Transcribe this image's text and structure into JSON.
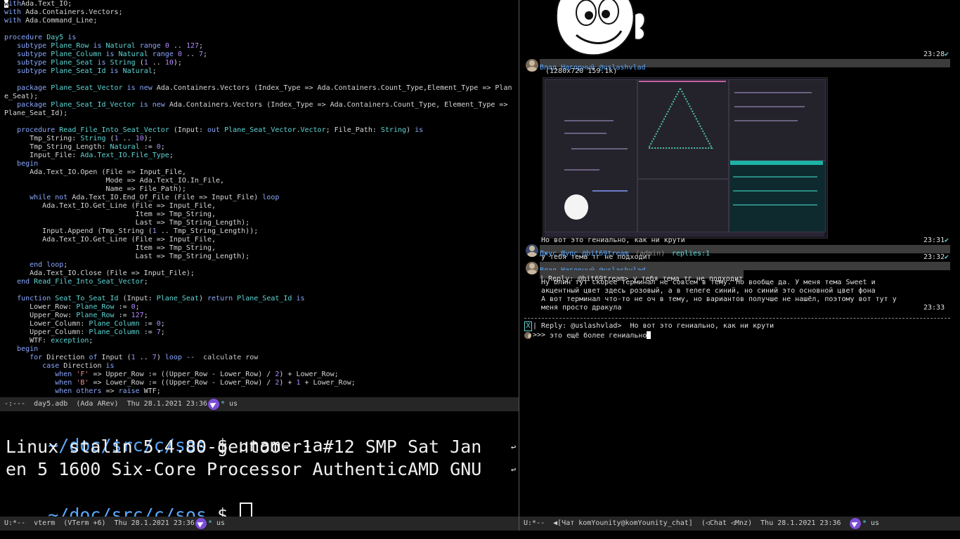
{
  "editor": {
    "lines": [
      [
        [
          "cur",
          "w"
        ],
        [
          "kw",
          "ith"
        ],
        [
          "",
          "Ada.Text_IO;"
        ]
      ],
      [
        [
          "kw",
          "with "
        ],
        [
          "",
          "Ada.Containers.Vectors;"
        ]
      ],
      [
        [
          "kw",
          "with "
        ],
        [
          "",
          "Ada.Command_Line;"
        ]
      ],
      [],
      [
        [
          "kw",
          "procedure "
        ],
        [
          "ty",
          "Day5 "
        ],
        [
          "kw",
          "is"
        ]
      ],
      [
        [
          "",
          "   "
        ],
        [
          "kw",
          "subtype "
        ],
        [
          "ty",
          "Plane_Row "
        ],
        [
          "kw",
          "is "
        ],
        [
          "ty",
          "Natural "
        ],
        [
          "kw",
          "range "
        ],
        [
          "nm",
          "0"
        ],
        [
          "",
          " .. "
        ],
        [
          "nm",
          "127"
        ],
        [
          "",
          ";"
        ]
      ],
      [
        [
          "",
          "   "
        ],
        [
          "kw",
          "subtype "
        ],
        [
          "ty",
          "Plane_Column "
        ],
        [
          "kw",
          "is "
        ],
        [
          "ty",
          "Natural "
        ],
        [
          "kw",
          "range "
        ],
        [
          "nm",
          "0"
        ],
        [
          "",
          " .. "
        ],
        [
          "nm",
          "7"
        ],
        [
          "",
          ";"
        ]
      ],
      [
        [
          "",
          "   "
        ],
        [
          "kw",
          "subtype "
        ],
        [
          "ty",
          "Plane_Seat "
        ],
        [
          "kw",
          "is "
        ],
        [
          "ty",
          "String "
        ],
        [
          "",
          "("
        ],
        [
          "nm",
          "1"
        ],
        [
          "",
          " .. "
        ],
        [
          "nm",
          "10"
        ],
        [
          "",
          "); "
        ]
      ],
      [
        [
          "",
          "   "
        ],
        [
          "kw",
          "subtype "
        ],
        [
          "ty",
          "Plane_Seat_Id "
        ],
        [
          "kw",
          "is "
        ],
        [
          "ty",
          "Natural"
        ],
        [
          "",
          ";"
        ]
      ],
      [],
      [
        [
          "",
          "   "
        ],
        [
          "kw",
          "package "
        ],
        [
          "ty",
          "Plane_Seat_Vector "
        ],
        [
          "kw",
          "is new "
        ],
        [
          "",
          "Ada.Containers.Vectors (Index_Type => Ada.Containers.Count_Type,Element_Type => Plan "
        ]
      ],
      [
        [
          "",
          "e_Seat);"
        ]
      ],
      [
        [
          "",
          "   "
        ],
        [
          "kw",
          "package "
        ],
        [
          "ty",
          "Plane_Seat_Id_Vector "
        ],
        [
          "kw",
          "is new "
        ],
        [
          "",
          "Ada.Containers.Vectors (Index_Type => Ada.Containers.Count_Type, Element_Type => "
        ]
      ],
      [
        [
          "",
          "Plane_Seat_Id);"
        ]
      ],
      [],
      [
        [
          "",
          "   "
        ],
        [
          "kw",
          "procedure "
        ],
        [
          "ty",
          "Read_File_Into_Seat_Vector "
        ],
        [
          "",
          "(Input: "
        ],
        [
          "kw",
          "out "
        ],
        [
          "ty",
          "Plane_Seat_Vector.Vector"
        ],
        [
          "",
          "; File_Path: "
        ],
        [
          "ty",
          "String"
        ],
        [
          "",
          ") "
        ],
        [
          "kw",
          "is"
        ]
      ],
      [
        [
          "",
          "      Tmp_String: "
        ],
        [
          "ty",
          "String "
        ],
        [
          "",
          "("
        ],
        [
          "nm",
          "1"
        ],
        [
          "",
          " .. "
        ],
        [
          "nm",
          "10"
        ],
        [
          "",
          ");"
        ]
      ],
      [
        [
          "",
          "      Tmp_String_Length: "
        ],
        [
          "ty",
          "Natural "
        ],
        [
          "",
          ":= "
        ],
        [
          "nm",
          "0"
        ],
        [
          "",
          ";"
        ]
      ],
      [
        [
          "",
          "      Input_File: "
        ],
        [
          "ty",
          "Ada.Text_IO.File_Type"
        ],
        [
          "",
          ";"
        ]
      ],
      [
        [
          "",
          "   "
        ],
        [
          "kw",
          "begin"
        ]
      ],
      [
        [
          "",
          "      Ada.Text_IO.Open (File => Input_File,"
        ]
      ],
      [
        [
          "",
          "                        Mode => Ada.Text_IO.In_File,"
        ]
      ],
      [
        [
          "",
          "                        Name => File_Path);"
        ]
      ],
      [
        [
          "",
          "      "
        ],
        [
          "kw",
          "while not "
        ],
        [
          "",
          "Ada.Text_IO.End_Of_File (File => Input_File) "
        ],
        [
          "kw",
          "loop"
        ]
      ],
      [
        [
          "",
          "         Ada.Text_IO.Get_Line (File => Input_File,"
        ]
      ],
      [
        [
          "",
          "                               Item => Tmp_String,"
        ]
      ],
      [
        [
          "",
          "                               Last => Tmp_String_Length);"
        ]
      ],
      [
        [
          "",
          "         Input.Append (Tmp_String ("
        ],
        [
          "nm",
          "1"
        ],
        [
          "",
          " .. Tmp_String_Length));"
        ]
      ],
      [
        [
          "",
          "         Ada.Text_IO.Get_Line (File => Input_File,"
        ]
      ],
      [
        [
          "",
          "                               Item => Tmp_String,"
        ]
      ],
      [
        [
          "",
          "                               Last => Tmp_String_Length);"
        ]
      ],
      [
        [
          "",
          "      "
        ],
        [
          "kw",
          "end loop"
        ],
        [
          "",
          ";"
        ]
      ],
      [
        [
          "",
          "      Ada.Text_IO.Close (File => Input_File);"
        ]
      ],
      [
        [
          "",
          "   "
        ],
        [
          "kw",
          "end "
        ],
        [
          "ty",
          "Read_File_Into_Seat_Vector"
        ],
        [
          "",
          ";"
        ]
      ],
      [],
      [
        [
          "",
          "   "
        ],
        [
          "kw",
          "function "
        ],
        [
          "ty",
          "Seat_To_Seat_Id "
        ],
        [
          "",
          "(Input: "
        ],
        [
          "ty",
          "Plane_Seat"
        ],
        [
          "",
          ") "
        ],
        [
          "kw",
          "return "
        ],
        [
          "ty",
          "Plane_Seat_Id "
        ],
        [
          "kw",
          "is"
        ]
      ],
      [
        [
          "",
          "      Lower_Row: "
        ],
        [
          "ty",
          "Plane_Row "
        ],
        [
          "",
          ":= "
        ],
        [
          "nm",
          "0"
        ],
        [
          "",
          ";"
        ]
      ],
      [
        [
          "",
          "      Upper_Row: "
        ],
        [
          "ty",
          "Plane_Row "
        ],
        [
          "",
          ":= "
        ],
        [
          "nm",
          "127"
        ],
        [
          "",
          ";"
        ]
      ],
      [
        [
          "",
          "      Lower_Column: "
        ],
        [
          "ty",
          "Plane_Column "
        ],
        [
          "",
          ":= "
        ],
        [
          "nm",
          "0"
        ],
        [
          "",
          ";"
        ]
      ],
      [
        [
          "",
          "      Upper_Column: "
        ],
        [
          "ty",
          "Plane_Column "
        ],
        [
          "",
          ":= "
        ],
        [
          "nm",
          "7"
        ],
        [
          "",
          ";"
        ]
      ],
      [
        [
          "",
          "      WTF: "
        ],
        [
          "ty",
          "exception"
        ],
        [
          "",
          ";"
        ]
      ],
      [
        [
          "",
          "   "
        ],
        [
          "kw",
          "begin"
        ]
      ],
      [
        [
          "",
          "      "
        ],
        [
          "kw",
          "for "
        ],
        [
          "",
          "Direction "
        ],
        [
          "kw",
          "of "
        ],
        [
          "",
          "Input ("
        ],
        [
          "nm",
          "1"
        ],
        [
          "",
          " .. "
        ],
        [
          "nm",
          "7"
        ],
        [
          "",
          ") "
        ],
        [
          "kw",
          "loop "
        ],
        [
          "cm",
          "--  calculate row"
        ]
      ],
      [
        [
          "",
          "         "
        ],
        [
          "kw",
          "case "
        ],
        [
          "",
          "Direction "
        ],
        [
          "kw",
          "is"
        ]
      ],
      [
        [
          "",
          "            "
        ],
        [
          "kw",
          "when "
        ],
        [
          "st",
          "'F' "
        ],
        [
          "",
          "=> Upper_Row := ((Upper_Row - Lower_Row) / "
        ],
        [
          "nm",
          "2"
        ],
        [
          "",
          ") + Lower_Row;"
        ]
      ],
      [
        [
          "",
          "            "
        ],
        [
          "kw",
          "when "
        ],
        [
          "st",
          "'B' "
        ],
        [
          "",
          "=> Lower_Row := ((Upper_Row - Lower_Row) / "
        ],
        [
          "nm",
          "2"
        ],
        [
          "",
          ") + "
        ],
        [
          "nm",
          "1"
        ],
        [
          "",
          " + Lower_Row;"
        ]
      ],
      [
        [
          "",
          "            "
        ],
        [
          "kw",
          "when others "
        ],
        [
          "",
          "=> "
        ],
        [
          "kw",
          "raise "
        ],
        [
          "",
          "WTF;"
        ]
      ]
    ],
    "modeline": "-:---  day5.adb  (Ada ARev)  Thu 28.1.2021 23:36",
    "modeline_star": "*",
    "modeline_us": "us"
  },
  "terminal": {
    "line1_prompt": "~/doc/src/c/sos",
    "line1_cmd": " $ uname -a",
    "line2": "Linux stalin 5.4.80-gentoo-r1 #12 SMP Sat Jan",
    "line3": "en 5 1600 Six-Core Processor AuthenticAMD GNU",
    "line4_prompt": "~/doc/src/c/sos",
    "line4_dollar": " $ ",
    "wrap_glyph": "↩",
    "modeline": "U:*--  vterm  (VTerm +6)  Thu 28.1.2021 23:36",
    "modeline_star": "*",
    "modeline_us": "us"
  },
  "chat": {
    "sticker_time": "23:28",
    "check": "✔",
    "msg1": {
      "sender": "Влад Нагорный @uslashvlad",
      "photo_caption": "(1280x720 159.1k)",
      "text": "Но вот это гениально, как ни крути",
      "time": "23:31"
    },
    "msg2": {
      "sender": "Джус Шупс @bit69tream",
      "admin": "(admin)",
      "replies": "replies:1",
      "text": "у тебя тема тг не подходит",
      "time": "23:32"
    },
    "msg3": {
      "sender": "Влад Нагорный @uslashvlad",
      "reply": "| Reply: @bit69tream> у тебя тема тг не подходит",
      "lines": [
        "Ну блин тут скорее терминал не совсем в тему. Но вообще да. У меня тема Sweet и",
        "акцентный цвет здесь розовый, а в телеге синий, но синий это основной цвет фона",
        "А вот терминал что-то не оч в тему, но вариантов получше не нашёл, поэтому вот тут у",
        "меня просто дракула"
      ],
      "time": "23:33"
    },
    "reply_tag": "X",
    "reply_line": "| Reply: @uslashvlad>  Но вот это гениально, как ни крути",
    "input_prompt": ">>> ",
    "input_text": "это ещё более гениально",
    "modeline": "U:*--  ◀[Чат komYounity@komYounity_chat]  (◁Chat ◁Mnz)  Thu 28.1.2021 23:36",
    "modeline_star": "*",
    "modeline_us": "us"
  },
  "colors": {
    "background": "#000000",
    "modeline": "#262626",
    "keyword": "#8aa8ff",
    "type": "#5fd7d7",
    "number": "#b38cff",
    "string": "#f08c8c",
    "prompt_path": "#5aa8ff",
    "telegram_icon": "#7c4dd8"
  }
}
